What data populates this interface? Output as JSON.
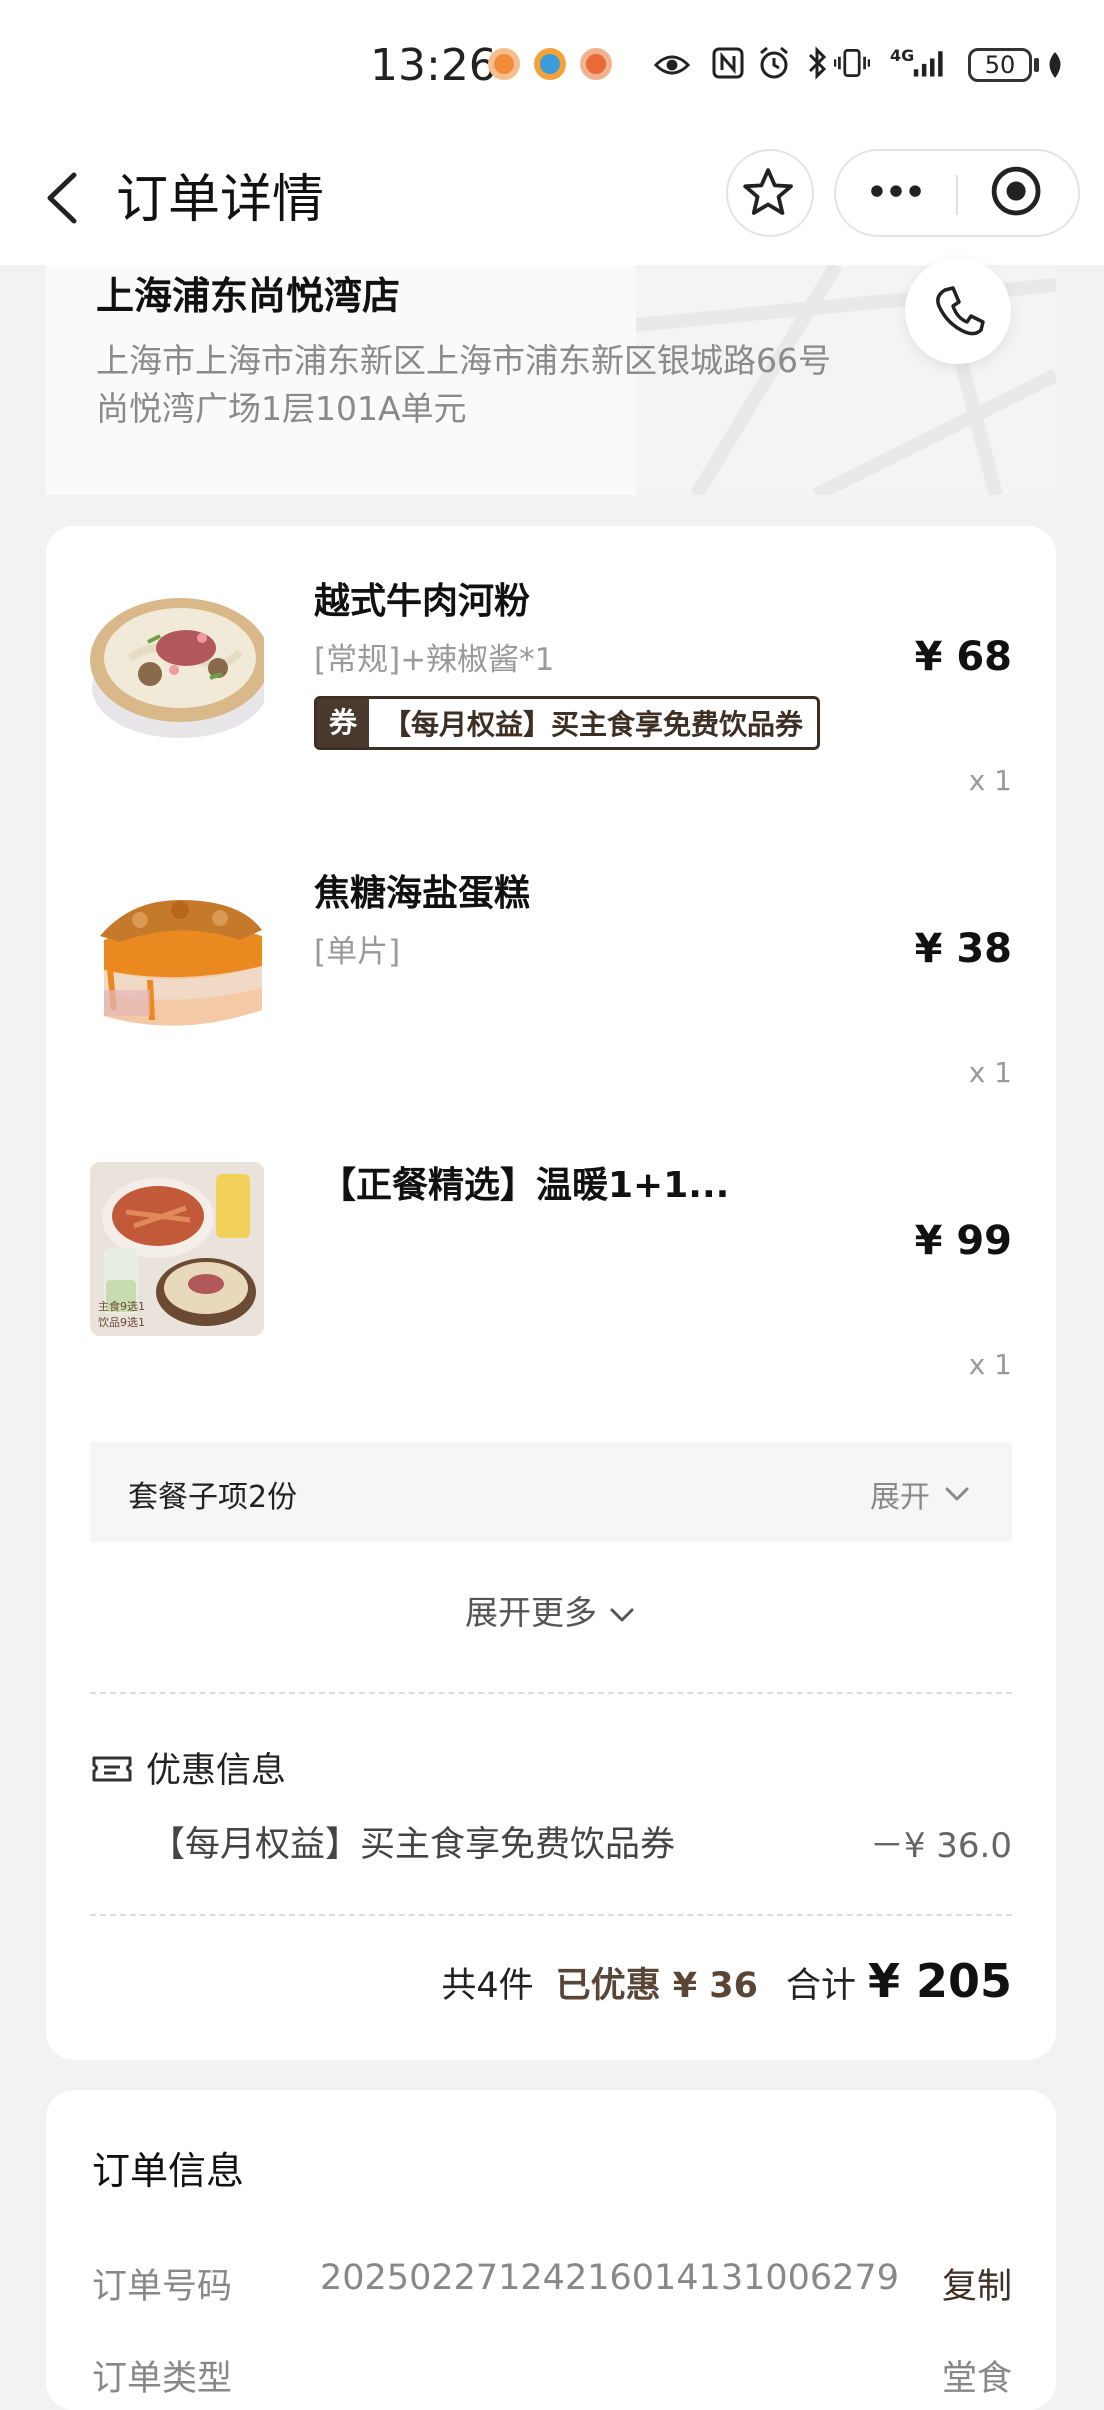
{
  "status_bar": {
    "time": "13:26",
    "battery": "50",
    "network": "4G"
  },
  "nav": {
    "title": "订单详情",
    "back_icon": "chevron-left-icon",
    "favorite_icon": "star-icon",
    "more_icon": "more-dots-icon",
    "close_icon": "target-close-icon"
  },
  "store": {
    "name": "上海浦东尚悦湾店",
    "address_line1": "上海市上海市浦东新区上海市浦东新区银城路66号",
    "address_line2": "尚悦湾广场1层101A单元",
    "phone_icon": "phone-icon"
  },
  "items": [
    {
      "name": "越式牛肉河粉",
      "spec": "[常规]+辣椒酱*1",
      "price": "¥ 68",
      "qty": "x 1",
      "coupon_mark": "券",
      "coupon_text": "【每月权益】买主食享免费饮品券",
      "image": "beef-pho-bowl"
    },
    {
      "name": "焦糖海盐蛋糕",
      "spec": "[单片]",
      "price": "¥ 38",
      "qty": "x 1",
      "image": "caramel-cake"
    },
    {
      "name": "【正餐精选】温暖1+1...",
      "spec": "",
      "price": "¥ 99",
      "qty": "x 1",
      "image": "combo-meal",
      "image_caption_1": "主食9选1",
      "image_caption_2": "饮品9选1"
    }
  ],
  "combo": {
    "label": "套餐子项2份",
    "toggle_label": "展开"
  },
  "expand_more": "展开更多",
  "promotion": {
    "title": "优惠信息",
    "line": "【每月权益】买主食享免费饮品券",
    "amount": "－¥ 36.0"
  },
  "totals": {
    "count": "共4件",
    "discount_label": "已优惠",
    "discount_amount": "¥ 36",
    "sum_label": "合计",
    "sum_amount": "¥ 205"
  },
  "order_info": {
    "title": "订单信息",
    "order_no_label": "订单号码",
    "order_no": "20250227124216014131006279",
    "copy_label": "复制",
    "row2_label": "订单类型",
    "row2_value": "堂食"
  },
  "colors": {
    "accent_brown": "#3e2f25",
    "discount_brown": "#5a4636",
    "page_bg": "#f2f2f2"
  }
}
